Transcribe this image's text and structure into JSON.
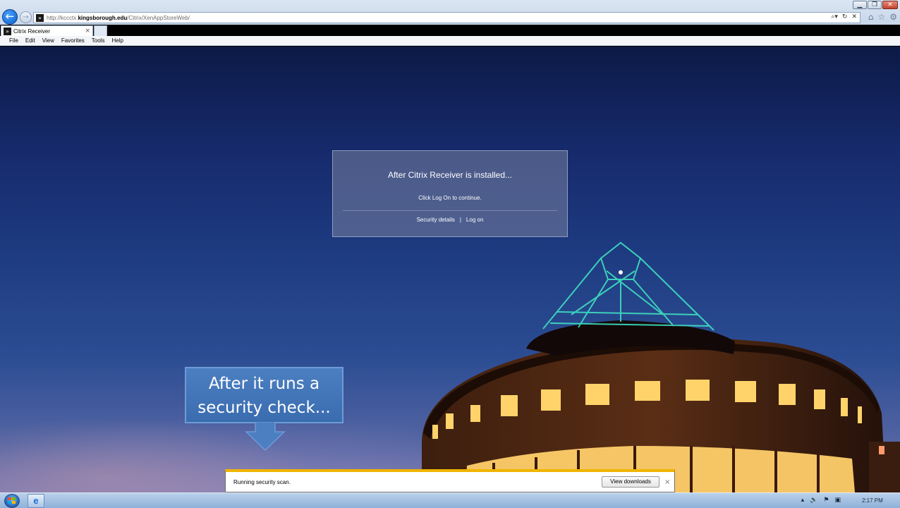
{
  "window": {
    "controls": [
      "minimize-icon",
      "restore-icon",
      "close-icon"
    ]
  },
  "addressbar": {
    "url_prefix": "http://kccctx.",
    "url_host": "kingsborough.edu",
    "url_path": "/Citrix/XenAppStoreWeb/"
  },
  "tab": {
    "label": "Citrix Receiver",
    "close": "×"
  },
  "menu": {
    "items": [
      "File",
      "Edit",
      "View",
      "Favorites",
      "Tools",
      "Help"
    ]
  },
  "dialog": {
    "title": "After Citrix Receiver is installed...",
    "message": "Click Log On to continue.",
    "security_link": "Security details",
    "separator": "|",
    "logon_link": "Log on"
  },
  "callout": {
    "line1": "After it runs a",
    "line2": "security check..."
  },
  "download_bar": {
    "message": "Running security scan.",
    "button_label": "View downloads",
    "close": "×"
  },
  "taskbar": {
    "clock": "2:17 PM"
  },
  "colors": {
    "notification_accent": "#f0b400",
    "callout_fill": "#4c7fc1",
    "dome_neon": "#3fe0c0",
    "window_glow": "#ffd36a"
  }
}
